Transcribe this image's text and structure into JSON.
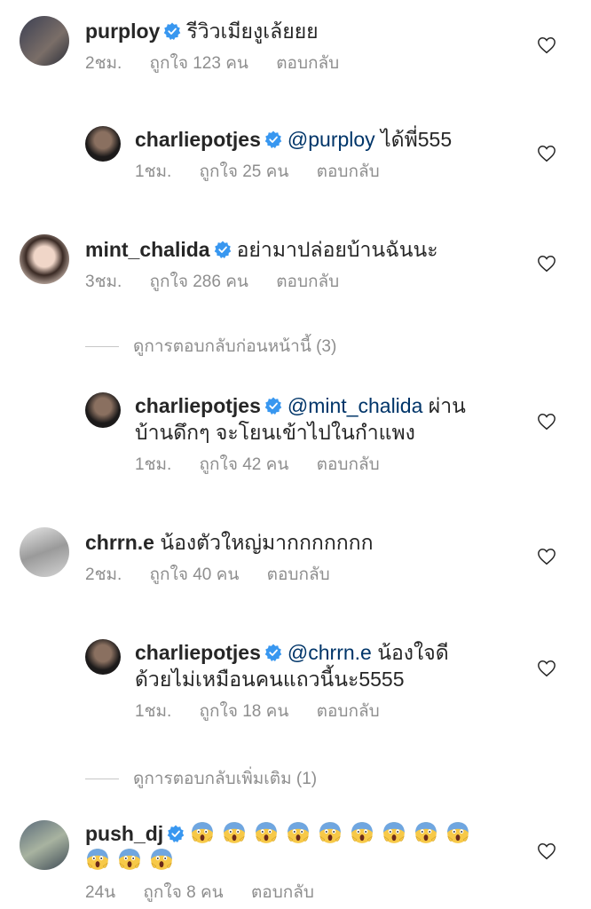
{
  "comments": [
    {
      "username": "purploy",
      "text": "รีวิวเมียงูเล้ยยย",
      "time": "2ชม.",
      "likes": "ถูกใจ 123 คน",
      "reply_label": "ตอบกลับ"
    },
    {
      "username": "charliepotjes",
      "mention": "@purploy",
      "text": "ได้พี่555",
      "time": "1ชม.",
      "likes": "ถูกใจ 25 คน",
      "reply_label": "ตอบกลับ"
    },
    {
      "username": "mint_chalida",
      "text": "อย่ามาปล่อยบ้านฉันนะ",
      "time": "3ชม.",
      "likes": "ถูกใจ 286 คน",
      "reply_label": "ตอบกลับ"
    },
    {
      "username": "charliepotjes",
      "mention": "@mint_chalida",
      "text": "ผ่าน",
      "text2": "บ้านดึกๆ จะโยนเข้าไปในกำแพง",
      "time": "1ชม.",
      "likes": "ถูกใจ 42 คน",
      "reply_label": "ตอบกลับ"
    },
    {
      "username": "chrrn.e",
      "text": "น้องตัวใหญ่มากกกกกกก",
      "time": "2ชม.",
      "likes": "ถูกใจ 40 คน",
      "reply_label": "ตอบกลับ"
    },
    {
      "username": "charliepotjes",
      "mention": "@chrrn.e",
      "text": "น้องใจดี",
      "text2": "ด้วยไม่เหมือนคนแถวนี้นะ5555",
      "time": "1ชม.",
      "likes": "ถูกใจ 18 คน",
      "reply_label": "ตอบกลับ"
    },
    {
      "username": "push_dj",
      "time": "24น",
      "likes": "ถูกใจ 8 คน",
      "reply_label": "ตอบกลับ"
    }
  ],
  "view_previous_replies": "ดูการตอบกลับก่อนหน้านี้ (3)",
  "view_more_replies": "ดูการตอบกลับเพิ่มเติม (1)",
  "colors": {
    "verified": "#3897f0",
    "mention": "#003569",
    "muted": "#8e8e8e"
  }
}
